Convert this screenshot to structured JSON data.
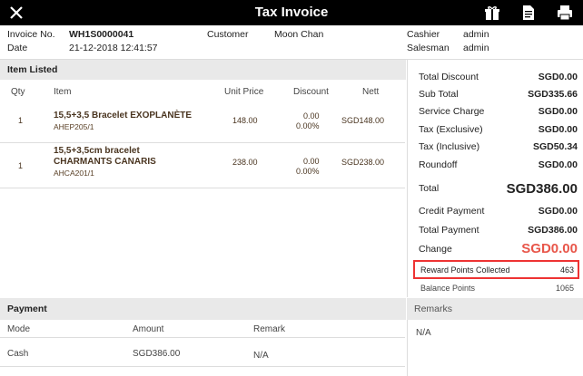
{
  "header": {
    "title": "Tax Invoice"
  },
  "invoice_info": {
    "invoice_no_label": "Invoice No.",
    "invoice_no": "WH1S0000041",
    "date_label": "Date",
    "date": "21-12-2018 12:41:57",
    "customer_label": "Customer",
    "customer": "Moon Chan",
    "cashier_label": "Cashier",
    "cashier": "admin",
    "salesman_label": "Salesman",
    "salesman": "admin"
  },
  "items": {
    "section_title": "Item Listed",
    "columns": [
      "Qty",
      "Item",
      "Unit Price",
      "Discount",
      "Nett"
    ],
    "rows": [
      {
        "qty": "1",
        "name_line1": "15,5+3,5 Bracelet  EXOPLANÈTE",
        "name_line2": "",
        "code": "AHEP205/1",
        "unit_price": "148.00",
        "discount": "0.00",
        "discount_pct": "0.00%",
        "nett": "SGD148.00"
      },
      {
        "qty": "1",
        "name_line1": "15,5+3,5cm bracelet",
        "name_line2": "CHARMANTS CANARIS",
        "code": "AHCA201/1",
        "unit_price": "238.00",
        "discount": "0.00",
        "discount_pct": "0.00%",
        "nett": "SGD238.00"
      }
    ]
  },
  "summary": {
    "total_discount_label": "Total Discount",
    "total_discount": "SGD0.00",
    "sub_total_label": "Sub Total",
    "sub_total": "SGD335.66",
    "service_charge_label": "Service Charge",
    "service_charge": "SGD0.00",
    "tax_exclusive_label": "Tax (Exclusive)",
    "tax_exclusive": "SGD0.00",
    "tax_inclusive_label": "Tax (Inclusive)",
    "tax_inclusive": "SGD50.34",
    "roundoff_label": "Roundoff",
    "roundoff": "SGD0.00",
    "total_label": "Total",
    "total": "SGD386.00",
    "credit_payment_label": "Credit Payment",
    "credit_payment": "SGD0.00",
    "total_payment_label": "Total Payment",
    "total_payment": "SGD386.00",
    "change_label": "Change",
    "change": "SGD0.00",
    "reward_label": "Reward Points Collected",
    "reward": "463",
    "balance_label": "Balance Points",
    "balance": "1065"
  },
  "payment": {
    "section_title": "Payment",
    "columns": [
      "Mode",
      "Amount",
      "Remark"
    ],
    "rows": [
      {
        "mode": "Cash",
        "amount": "SGD386.00",
        "remark": "N/A"
      }
    ]
  },
  "remarks": {
    "section_title": "Remarks",
    "value": "N/A"
  },
  "colors": {
    "accent_red": "#e8564a",
    "highlight_border": "#e33",
    "topbar": "#000000"
  }
}
